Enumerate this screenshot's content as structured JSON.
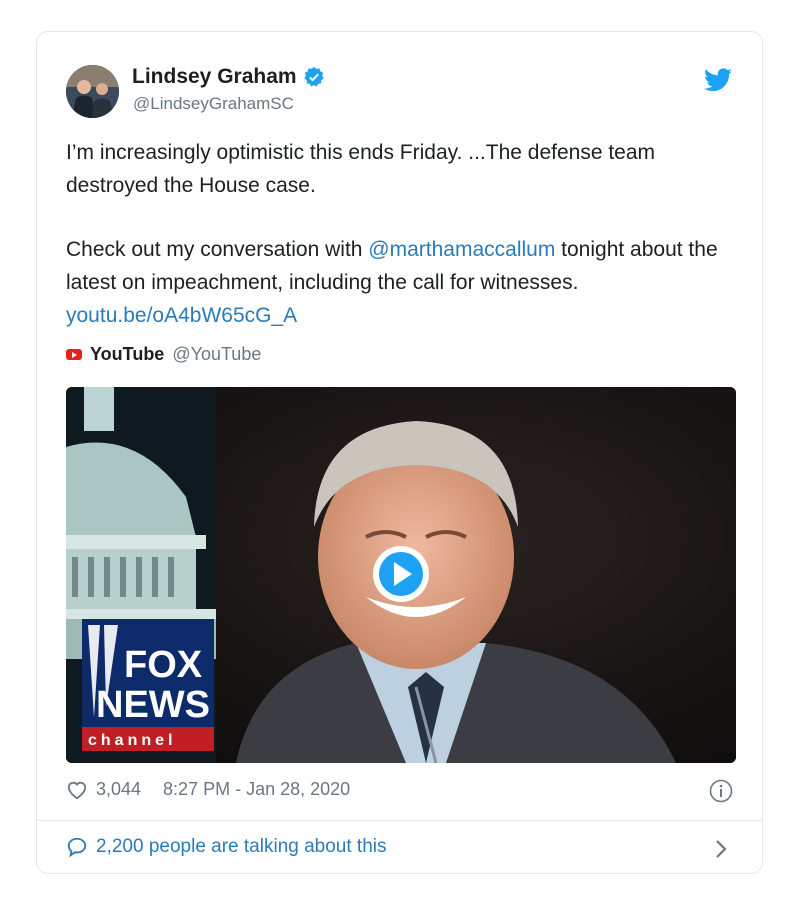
{
  "author": {
    "name": "Lindsey Graham",
    "handle": "@LindseyGrahamSC"
  },
  "tweet": {
    "paragraph1": "I’m increasingly optimistic this ends Friday. ...The defense team destroyed the House case.",
    "p2_part1": "Check out my conversation with ",
    "mention": "@marthamaccallum",
    "p2_part2": " tonight about the latest on impeachment, including the call for witnesses. ",
    "link": "youtu.be/oA4bW65cG_A"
  },
  "source": {
    "name": "YouTube",
    "handle": "@YouTube"
  },
  "media": {
    "logo_line1": "FOX",
    "logo_line2": "NEWS",
    "logo_line3": "channel"
  },
  "footer": {
    "likes": "3,044",
    "timestamp": "8:27 PM - Jan 28, 2020",
    "talking": "2,200 people are talking about this"
  },
  "colors": {
    "link": "#2b7bb9",
    "verified": "#1da1f2",
    "muted": "#697882"
  },
  "icons": [
    "verified-icon",
    "twitter-bird-icon",
    "youtube-icon",
    "play-icon",
    "heart-icon",
    "info-icon",
    "comment-icon",
    "chevron-right-icon"
  ]
}
